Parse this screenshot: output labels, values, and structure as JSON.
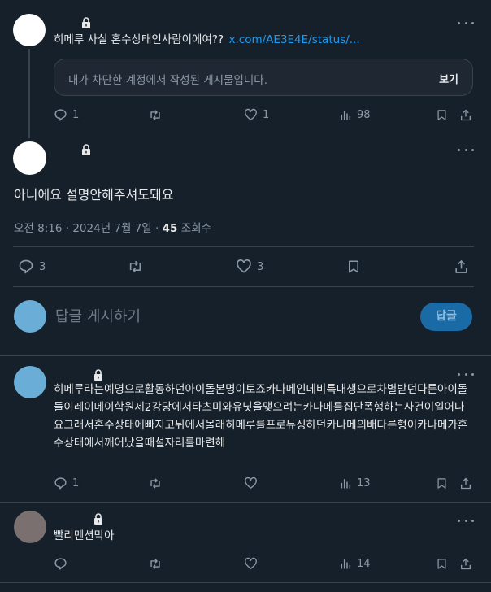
{
  "reply1": {
    "text": "히메루 사실 혼수상태인사람이에여??",
    "link": "x.com/AE3E4E/status/...",
    "notice": "내가 차단한 계정에서 작성된 게시물입니다.",
    "view_button": "보기",
    "stats": {
      "replies": "1",
      "likes": "1",
      "views": "98"
    }
  },
  "main": {
    "text": "아니에요 설명안해주셔도돼요",
    "time": "오전 8:16",
    "dot1": "·",
    "date": "2024년 7월 7일",
    "dot2": "·",
    "views": "45",
    "views_label": "조회수",
    "stats": {
      "replies": "3",
      "likes": "3"
    }
  },
  "compose": {
    "placeholder": "답글 게시하기",
    "button": "답글"
  },
  "reply2": {
    "text": "히메루라는예명으로활동하던아이돌본명이토죠카나메인데비특대생으로차별받던다른아이돌들이레이메이학원제2강당에서타츠미와유닛을맺으려는카나메를집단폭행하는사건이일어나요그래서혼수상태에빠지고뒤에서몰래히메루를프로듀싱하던카나메의배다른형이카나메가혼수상태에서깨어났을때설자리를마련해",
    "stats": {
      "replies": "1",
      "views": "13"
    }
  },
  "reply3": {
    "text": "빨리멘션막아",
    "stats": {
      "views": "14"
    }
  },
  "colors": {
    "background": "#15202b",
    "border": "#38444d",
    "muted": "#8b98a5",
    "accent": "#1d9bf0",
    "reply_button": "#1a6aa6"
  }
}
